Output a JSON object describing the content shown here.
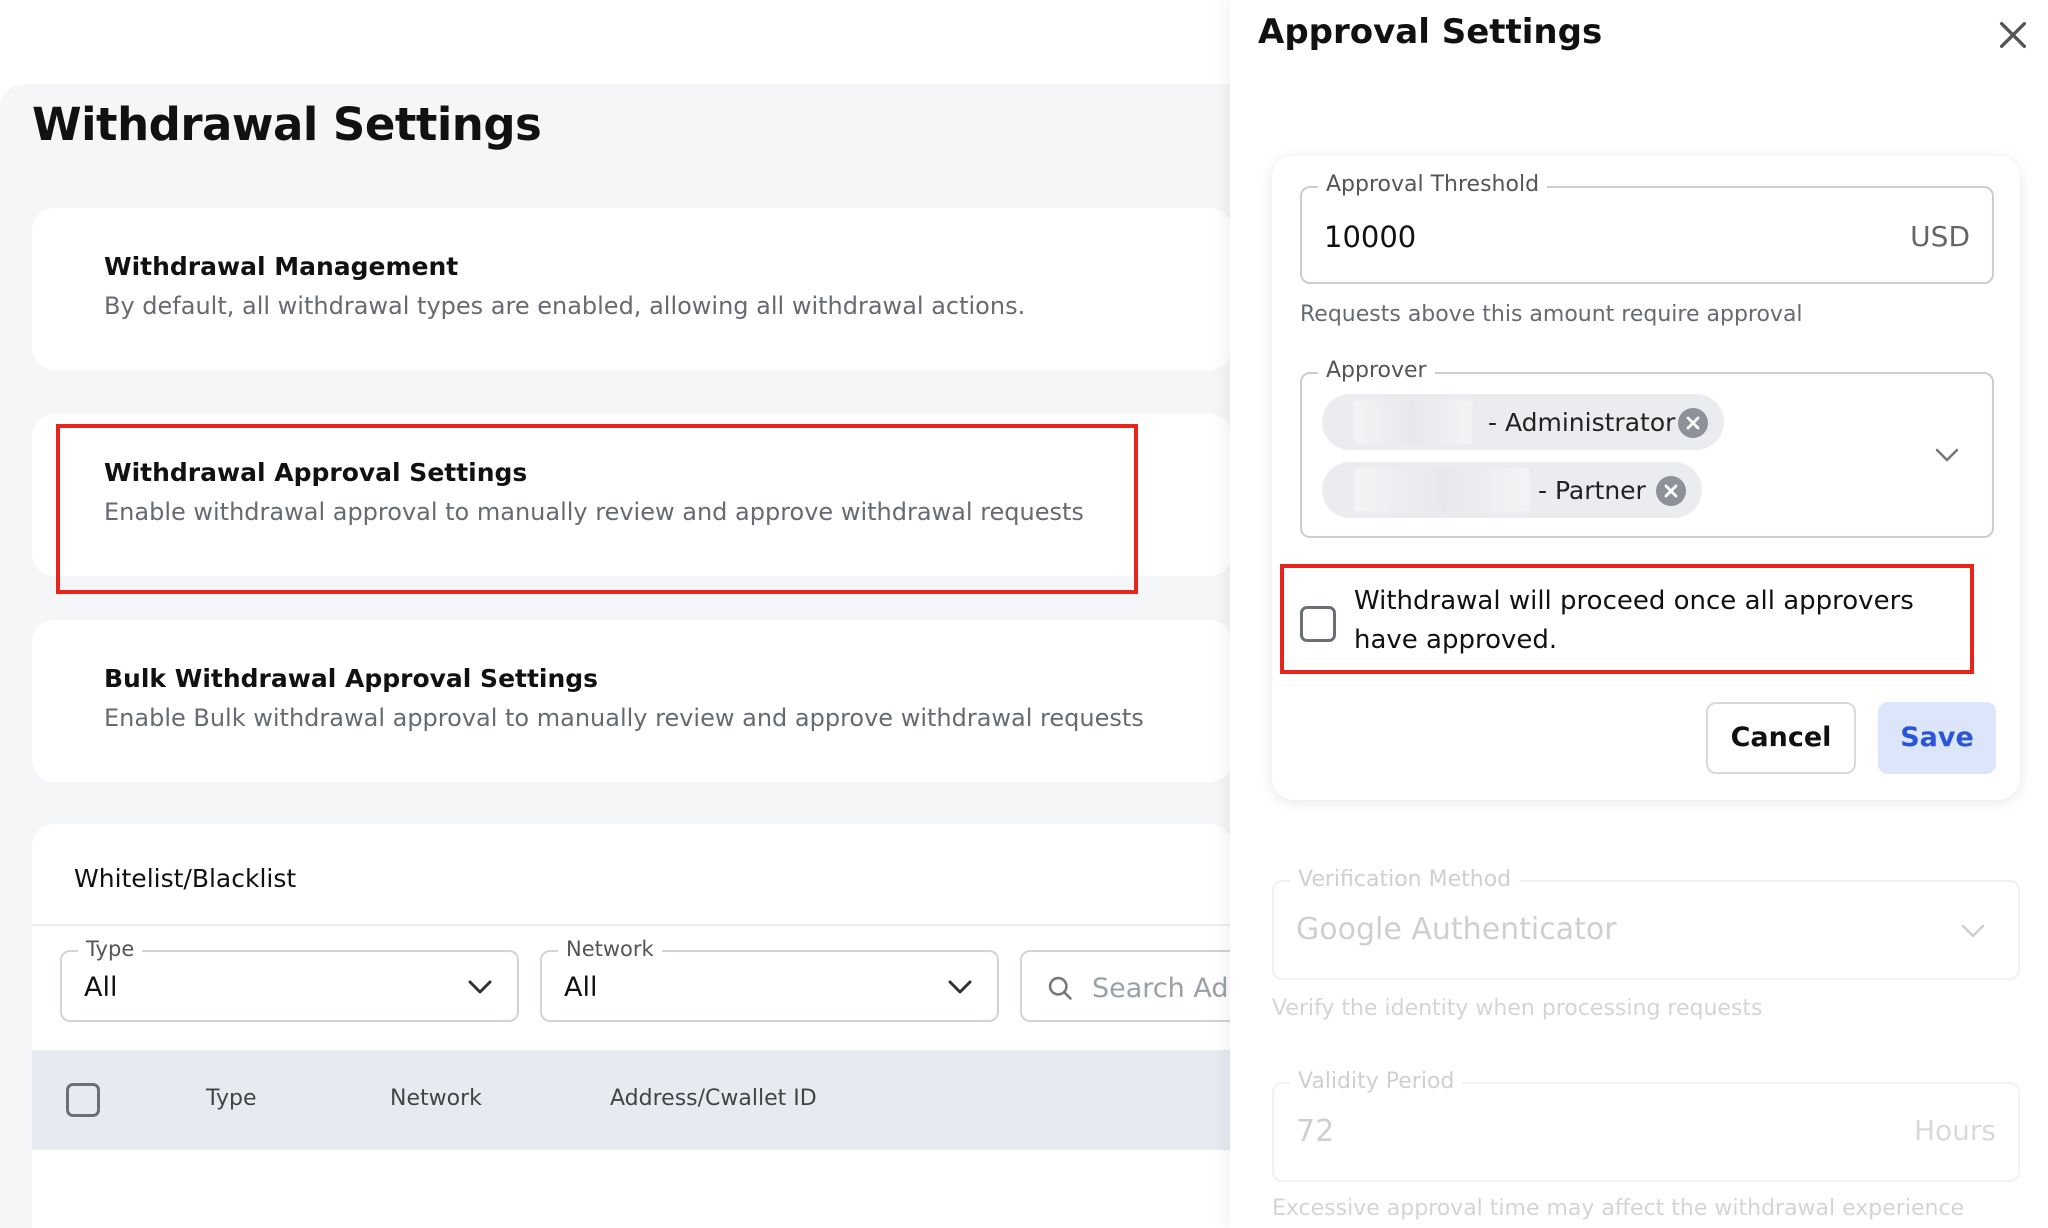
{
  "page": {
    "title": "Withdrawal Settings"
  },
  "cards": {
    "management": {
      "title": "Withdrawal Management",
      "description": "By default, all withdrawal types are enabled, allowing all withdrawal actions."
    },
    "approval": {
      "title": "Withdrawal Approval Settings",
      "description": "Enable withdrawal approval to manually review and approve withdrawal requests"
    },
    "bulk": {
      "title": "Bulk Withdrawal Approval Settings",
      "description": "Enable Bulk withdrawal approval to manually review and approve withdrawal requests"
    }
  },
  "whitelist": {
    "title": "Whitelist/Blacklist",
    "filters": {
      "type_label": "Type",
      "type_value": "All",
      "network_label": "Network",
      "network_value": "All",
      "search_placeholder": "Search Add"
    },
    "columns": [
      "Type",
      "Network",
      "Address/Cwallet ID"
    ]
  },
  "drawer": {
    "title": "Approval Settings",
    "threshold": {
      "label": "Approval Threshold",
      "value": "10000",
      "unit": "USD",
      "helper": "Requests above this amount require approval"
    },
    "approver": {
      "label": "Approver",
      "chips": [
        {
          "role": "- Administrator"
        },
        {
          "role": "- Partner"
        }
      ]
    },
    "all_approvers_checkbox": {
      "label": "Withdrawal will proceed once all approvers have approved.",
      "checked": false
    },
    "buttons": {
      "cancel": "Cancel",
      "save": "Save"
    },
    "verification": {
      "label": "Verification Method",
      "value": "Google Authenticator",
      "helper": "Verify the identity when processing requests"
    },
    "validity": {
      "label": "Validity Period",
      "value": "72",
      "unit": "Hours",
      "helper": "Excessive approval time may affect the withdrawal experience"
    }
  },
  "colors": {
    "highlight": "#e8251b",
    "save_bg": "#dde5fb",
    "save_text": "#2b55d9",
    "table_header_bg": "#e7ebf1"
  }
}
